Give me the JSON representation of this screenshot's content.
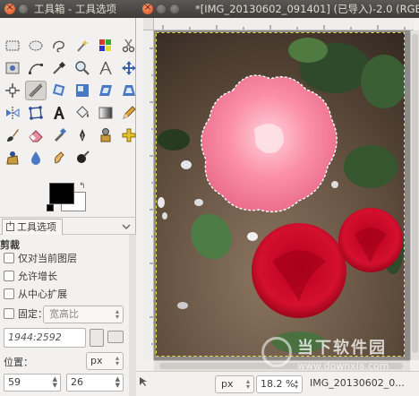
{
  "toolbox": {
    "title": "工具箱 - 工具选项",
    "tools": [
      "rect-select-icon",
      "ellipse-select-icon",
      "free-select-icon",
      "fuzzy-select-icon",
      "color-select-icon",
      "scissors-icon",
      "foreground-select-icon",
      "paths-icon",
      "color-picker-icon",
      "zoom-icon",
      "measure-icon",
      "move-icon",
      "align-icon",
      "crop-icon",
      "rotate-icon",
      "scale-icon",
      "shear-icon",
      "perspective-icon",
      "flip-icon",
      "cage-transform-icon",
      "text-icon",
      "bucket-fill-icon",
      "blend-icon",
      "pencil-icon",
      "paintbrush-icon",
      "eraser-icon",
      "airbrush-icon",
      "ink-icon",
      "clone-icon",
      "heal-icon",
      "perspective-clone-icon",
      "blur-icon",
      "smudge-icon",
      "dodge-burn-icon"
    ],
    "active_tool": 7,
    "fg_color": "#000000",
    "bg_color": "#ffffff"
  },
  "tool_options": {
    "tab_label": "工具选项",
    "heading": "剪裁",
    "current_layer_only": "仅对当前图层",
    "allow_growing": "允许增长",
    "expand_from_center": "从中心扩展",
    "fixed_label": "固定：",
    "fixed_value": "宽高比",
    "ratio_value": "1944:2592",
    "position_label": "位置：",
    "position_unit": "px",
    "pos_x": "59",
    "pos_y": "26"
  },
  "image_window": {
    "title": "*[IMG_20130602_091401] (已导入)-2.0 (RGB",
    "status_unit": "px",
    "zoom": "18.2 %",
    "status_file": "IMG_20130602_0..."
  },
  "watermark": {
    "text": "当下软件园",
    "url": "www.downxia.com"
  },
  "colors": {
    "titlebar": "#3d3c38",
    "close_button": "#de4b18",
    "selection": "#ffffff"
  }
}
